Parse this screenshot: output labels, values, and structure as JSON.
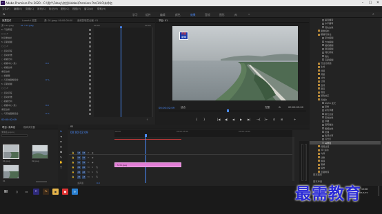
{
  "window": {
    "title": "Adobe Premiere Pro 2020 - C:\\用户\\Fsboy\\文档\\Adobe\\Premiere Pro\\14.0\\未命名",
    "app_icon": "Pr"
  },
  "menubar": {
    "items": [
      "文件(F)",
      "编辑(E)",
      "剪辑(C)",
      "序列(S)",
      "标记(M)",
      "图形(G)",
      "视图(V)",
      "窗口(W)",
      "帮助(H)"
    ]
  },
  "workspaces": {
    "items": [
      "学习",
      "组件",
      "编辑",
      "颜色",
      "效果",
      "音频",
      "图形",
      "库"
    ],
    "active": "效果"
  },
  "effect_controls": {
    "tabs": [
      "效果控件",
      "Lumetri 范围",
      "源: 01.jpeg: 00:00:00:00",
      "音频剪辑混合器: 01"
    ],
    "source_label": "源 * 01.jpeg",
    "clip_label": "01 * 01.jpeg",
    "time_start": "00:00",
    "time_end": "00:00",
    "rows": [
      {
        "label": "fx  不透明度",
        "value": ""
      },
      {
        "label": "○ □ ✐",
        "value": ""
      },
      {
        "label": "   时间重映射",
        "value": ""
      },
      {
        "label": "fx  高斯模糊",
        "value": ""
      },
      {
        "label": "○ □ ✐",
        "value": ""
      },
      {
        "label": "  ○ 自动高度",
        "value": ""
      },
      {
        "label": "  ○ 自动补偿",
        "value": ""
      },
      {
        "label": "  ○ 模糊方向",
        "value": ""
      },
      {
        "label": "  ○ 模糊中心 (准)",
        "value": "0.0"
      },
      {
        "label": "  ○ 模糊边缘",
        "value": ""
      },
      {
        "label": "     重复边缘",
        "value": ""
      },
      {
        "label": "  ○ 模糊量",
        "value": ""
      },
      {
        "label": "  ○ 与原始图像混合",
        "value": "0 %"
      },
      {
        "label": "fx  高斯模糊",
        "value": ""
      },
      {
        "label": "○ □ ✐",
        "value": ""
      },
      {
        "label": "  ○ 自动高度",
        "value": ""
      },
      {
        "label": "  ○ 自动补偿",
        "value": ""
      },
      {
        "label": "  ○ 模糊方向",
        "value": ""
      },
      {
        "label": "  ○ 模糊中心 (准)",
        "value": "0.0"
      },
      {
        "label": "     重复边缘",
        "value": ""
      },
      {
        "label": "  ○ 与原始图像混合",
        "value": "0 %"
      }
    ],
    "current_time": "00:00:02:09"
  },
  "program_monitor": {
    "tab": "节目: 01",
    "timecode": "00:00:02:09",
    "fit": "适合",
    "quality": "完整",
    "duration": "00:00:05:00",
    "logo_line1": "央视",
    "logo_line2": "新闻",
    "controls": [
      "{",
      "}",
      "|◀",
      "◀|",
      "◀",
      "▶",
      "▶|",
      "→{",
      "}←",
      "⊡",
      "⊞",
      "+"
    ]
  },
  "effects_panel": {
    "items": [
      {
        "label": "垂直翻转",
        "folder": false
      },
      {
        "label": "水平翻转",
        "folder": false
      },
      {
        "label": "羽化边缘",
        "folder": false
      },
      {
        "label": "图像控制",
        "folder": true
      },
      {
        "label": "模糊与锐化",
        "folder": true
      },
      {
        "label": "复合模糊",
        "folder": false
      },
      {
        "label": "方向模糊",
        "folder": false
      },
      {
        "label": "相机模糊",
        "folder": false
      },
      {
        "label": "通道模糊",
        "folder": false
      },
      {
        "label": "钝化蒙版",
        "folder": false
      },
      {
        "label": "锐化",
        "folder": false
      },
      {
        "label": "高斯模糊",
        "folder": false
      },
      {
        "label": "沉浸式视频",
        "folder": true
      },
      {
        "label": "生成",
        "folder": true
      },
      {
        "label": "视频",
        "folder": true
      },
      {
        "label": "调整",
        "folder": true
      },
      {
        "label": "过时",
        "folder": true
      },
      {
        "label": "过渡",
        "folder": true
      },
      {
        "label": "透视",
        "folder": true
      },
      {
        "label": "通道",
        "folder": true
      },
      {
        "label": "键控",
        "folder": true
      },
      {
        "label": "颜色校正",
        "folder": true
      },
      {
        "label": "风格化",
        "folder": true
      },
      {
        "label": "Alpha 发光",
        "folder": false
      },
      {
        "label": "复制",
        "folder": false
      },
      {
        "label": "彩色浮雕",
        "folder": false
      },
      {
        "label": "曝光过度",
        "folder": false
      },
      {
        "label": "查找边缘",
        "folder": false
      },
      {
        "label": "浮雕",
        "folder": false
      },
      {
        "label": "画笔描边",
        "folder": false
      },
      {
        "label": "粗糙边缘",
        "folder": false
      },
      {
        "label": "纹理",
        "folder": false
      },
      {
        "label": "色调分离",
        "folder": false
      },
      {
        "label": "闪光灯",
        "folder": false
      },
      {
        "label": "马赛克",
        "folder": false
      },
      {
        "label": "视频过渡",
        "folder": true
      },
      {
        "label": "3D 运动",
        "folder": true
      },
      {
        "label": "内滑",
        "folder": true
      },
      {
        "label": "划像",
        "folder": true
      },
      {
        "label": "擦除",
        "folder": true
      },
      {
        "label": "溶解",
        "folder": true
      },
      {
        "label": "缩放",
        "folder": true
      },
      {
        "label": "页面剥落",
        "folder": true
      }
    ],
    "selected": "马赛克",
    "footer1": "基本图形",
    "footer2": "基本声音"
  },
  "project_panel": {
    "tabs": [
      "项目: 未命名",
      "媒体浏览器"
    ],
    "search_placeholder": "",
    "project_name": "未命名.prproj",
    "thumbs": [
      {
        "name": "01.jpeg",
        "dur": "5:00"
      },
      {
        "name": "02.jpeg",
        "dur": "5:00"
      },
      {
        "name": "01",
        "dur": "5:00"
      }
    ]
  },
  "timeline": {
    "tab": "01",
    "timecode": "00:00:02:09",
    "ruler_labels": [
      ":00:00",
      "00:00:05:00",
      "00:00:10:00",
      "00:00:15:00"
    ],
    "tracks_video": [
      "V3",
      "V2",
      "V1"
    ],
    "tracks_audio": [
      "A1",
      "A2",
      "A3"
    ],
    "master": "主声道",
    "master_value": "0.0",
    "clip_label": "fx 01.jpeg"
  },
  "taskbar": {
    "time": "15:08",
    "date": "2021/1/19",
    "lang": "中"
  },
  "watermark": "最需教育",
  "colors": {
    "accent": "#4a8cff",
    "clip_pink": "#e27fd6",
    "watermark": "#2b2bd6"
  }
}
